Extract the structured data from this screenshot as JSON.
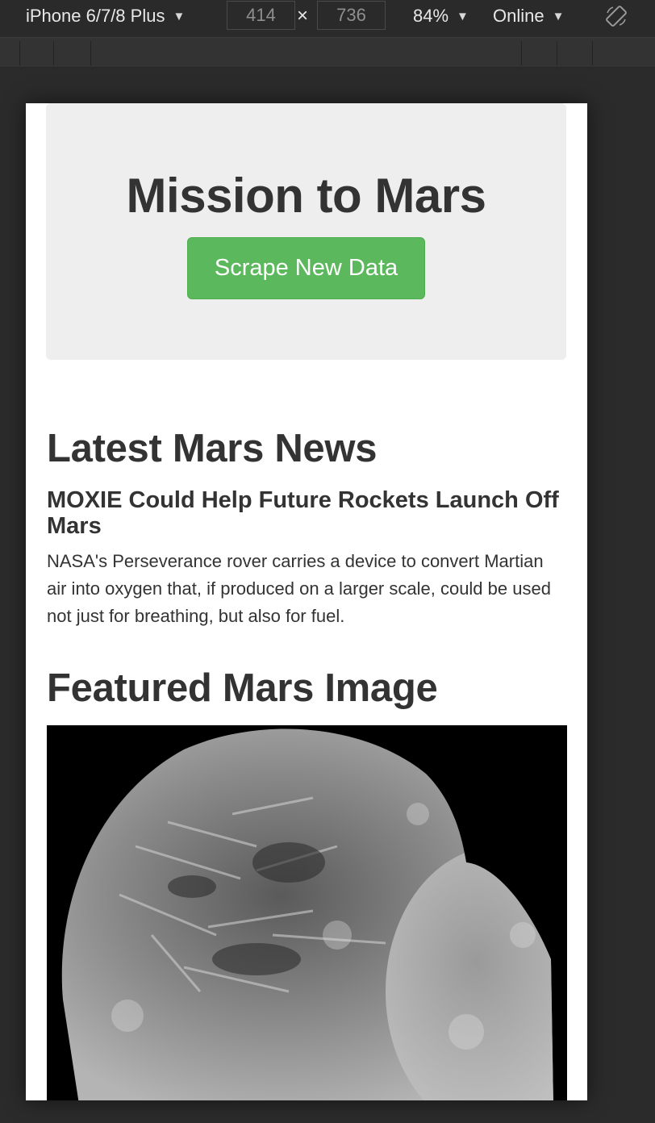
{
  "devtools": {
    "device_name": "iPhone 6/7/8 Plus",
    "width": "414",
    "height": "736",
    "times_symbol": "×",
    "zoom": "84%",
    "throttle": "Online",
    "caret": "▼",
    "rotate_icon": "rotate-icon"
  },
  "page": {
    "hero_title": "Mission to Mars",
    "scrape_button": "Scrape New Data",
    "news_heading": "Latest Mars News",
    "news_title": "MOXIE Could Help Future Rockets Launch Off Mars",
    "news_body": "NASA's Perseverance rover carries a device to convert Martian air into oxygen that, if produced on a larger scale, could be used not just for breathing, but also for fuel.",
    "image_heading": "Featured Mars Image"
  },
  "colors": {
    "button_green": "#5cb85c",
    "jumbotron_bg": "#eeeeee",
    "text": "#333333"
  }
}
